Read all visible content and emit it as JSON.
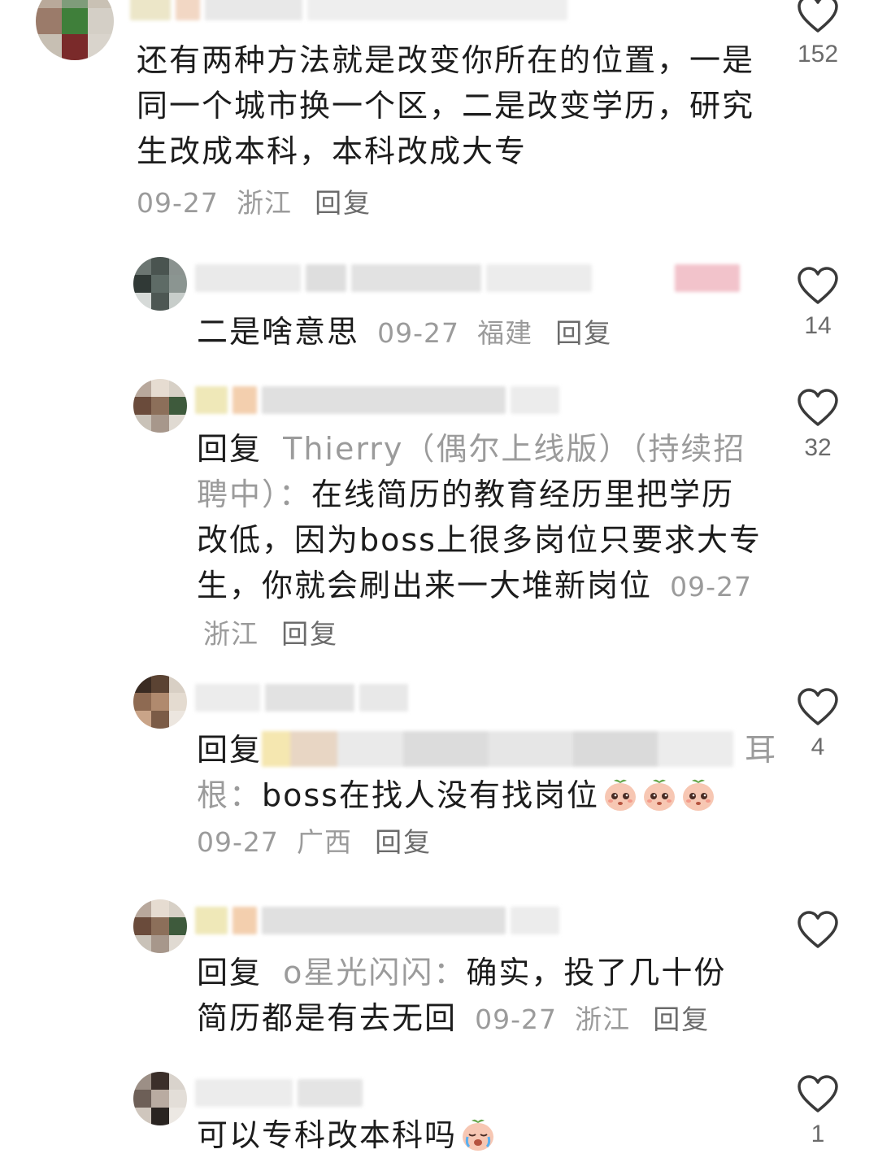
{
  "comments": [
    {
      "text": "还有两种方法就是改变你所在的位置，一是同一个城市换一个区，二是改变学历，研究生改成本科，本科改成大专",
      "date": "09-27",
      "location": "浙江",
      "reply_label": "回复",
      "likes": "152"
    },
    {
      "text": "二是啥意思",
      "date": "09-27",
      "location": "福建",
      "reply_label": "回复",
      "likes": "14"
    },
    {
      "prefix": "回复",
      "target": "Thierry（偶尔上线版）（持续招聘中）：",
      "text": "在线简历的教育经历里把学历改低，因为boss上很多岗位只要求大专生，你就会刷出来一大堆新岗位",
      "date": "09-27",
      "location": "浙江",
      "reply_label": "回复",
      "likes": "32"
    },
    {
      "prefix": "回复",
      "target": "耳根：",
      "text": "boss在找人没有找岗位",
      "date": "09-27",
      "location": "广西",
      "reply_label": "回复",
      "likes": "4"
    },
    {
      "prefix": "回复",
      "target": "o星光闪闪：",
      "text": "确实，投了几十份简历都是有去无回",
      "date": "09-27",
      "location": "浙江",
      "reply_label": "回复",
      "likes": ""
    },
    {
      "text": "可以专科改本科吗",
      "likes": "1"
    }
  ],
  "icons": {
    "like": "heart-outline-icon",
    "emoji": "crying-peach-emoji"
  },
  "colors": {
    "text": "#1c1c1c",
    "meta": "#9b9b9b",
    "reply_link": "#6b6b6b",
    "heart_stroke": "#3a3a3a"
  }
}
